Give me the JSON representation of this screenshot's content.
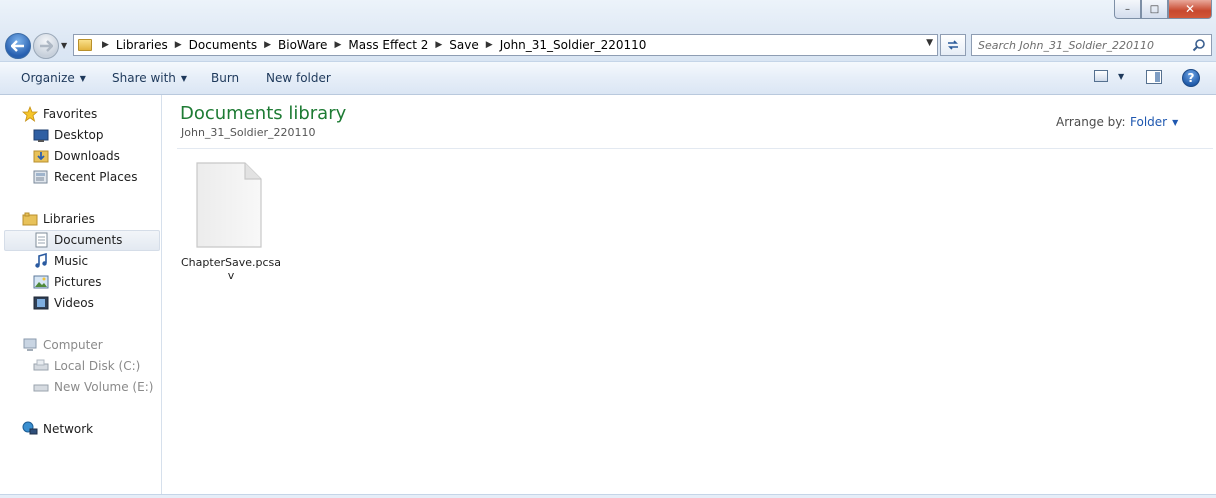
{
  "window": {
    "minimize_glyph": "–",
    "maximize_glyph": "□",
    "close_glyph": "✕"
  },
  "address": {
    "breadcrumb": [
      "Libraries",
      "Documents",
      "BioWare",
      "Mass Effect 2",
      "Save",
      "John_31_Soldier_220110"
    ]
  },
  "search": {
    "placeholder": "Search John_31_Soldier_220110"
  },
  "toolbar": {
    "organize": "Organize",
    "share_with": "Share with",
    "burn": "Burn",
    "new_folder": "New folder",
    "help_glyph": "?"
  },
  "nav": {
    "favorites": "Favorites",
    "desktop": "Desktop",
    "downloads": "Downloads",
    "recent_places": "Recent Places",
    "libraries": "Libraries",
    "documents": "Documents",
    "music": "Music",
    "pictures": "Pictures",
    "videos": "Videos",
    "computer": "Computer",
    "local_disk": "Local Disk (C:)",
    "new_volume": "New Volume (E:)",
    "network": "Network"
  },
  "content": {
    "title": "Documents library",
    "subtitle": "John_31_Soldier_220110",
    "arrange_label": "Arrange by:",
    "arrange_value": "Folder",
    "files": [
      {
        "name": "ChapterSave.pcsav",
        "icon": "blank-file-icon"
      }
    ]
  },
  "colors": {
    "library_title": "#1e7b34",
    "link_blue": "#1f58b0"
  }
}
